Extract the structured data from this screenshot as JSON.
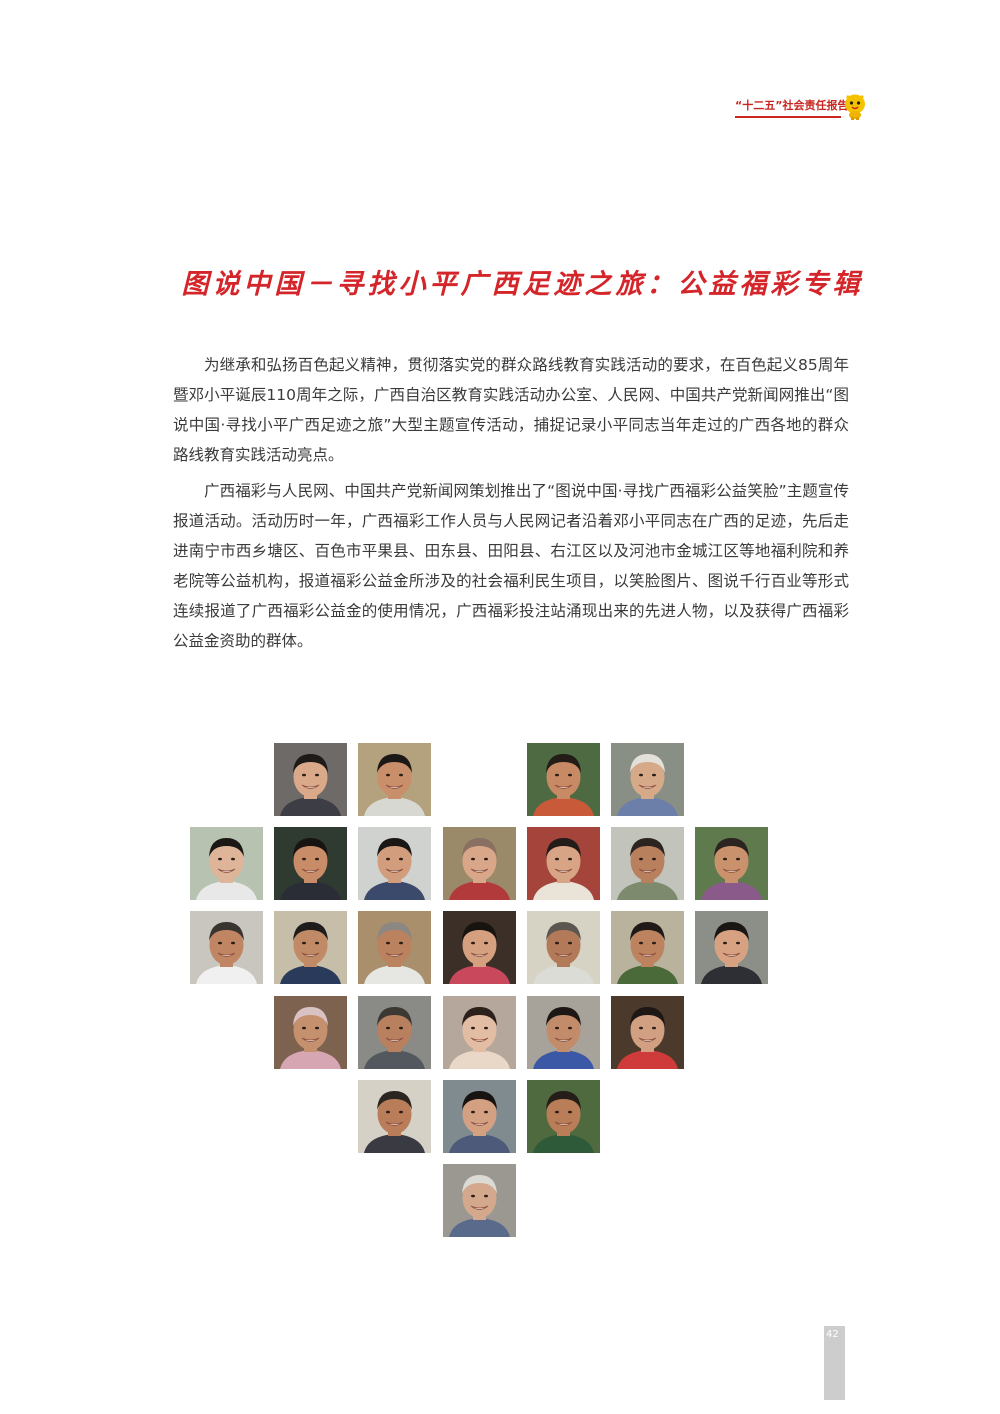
{
  "header": {
    "report_label": "“十二五”社会责任报告",
    "accent_color": "#c8261f",
    "mascot_icon": "mascot-icon"
  },
  "title": "图说中国－寻找小平广西足迹之旅：公益福彩专辑",
  "paragraphs": [
    "为继承和弘扬百色起义精神，贯彻落实党的群众路线教育实践活动的要求，在百色起义85周年暨邓小平诞辰110周年之际，广西自治区教育实践活动办公室、人民网、中国共产党新闻网推出“图说中国·寻找小平广西足迹之旅”大型主题宣传活动，捕捉记录小平同志当年走过的广西各地的群众路线教育实践活动亮点。",
    "广西福彩与人民网、中国共产党新闻网策划推出了“图说中国·寻找广西福彩公益笑脸”主题宣传报道活动。活动历时一年，广西福彩工作人员与人民网记者沿着邓小平同志在广西的足迹，先后走进南宁市西乡塘区、百色市平果县、田东县、田阳县、右江区以及河池市金城江区等地福利院和养老院等公益机构，报道福彩公益金所涉及的社会福利民生项目，以笑脸图片、图说千行百业等形式连续报道了广西福彩公益金的使用情况，广西福彩投注站涌现出来的先进人物，以及获得广西福彩公益金资助的群体。"
  ],
  "portraits": [
    {
      "row": 0,
      "col": 1,
      "bg": "#6d6a68",
      "skin": "#d9a98a",
      "hair": "#1e1a18",
      "shirt": "#3d3d45"
    },
    {
      "row": 0,
      "col": 2,
      "bg": "#b4a27e",
      "skin": "#c98f6b",
      "hair": "#1c1816",
      "shirt": "#d8d8d2"
    },
    {
      "row": 0,
      "col": 4,
      "bg": "#4e6a43",
      "skin": "#c78a64",
      "hair": "#231c17",
      "shirt": "#c85a3a"
    },
    {
      "row": 0,
      "col": 5,
      "bg": "#8a8f86",
      "skin": "#d6a988",
      "hair": "#e3e0da",
      "shirt": "#6b7fa8"
    },
    {
      "row": 1,
      "col": 0,
      "bg": "#b8c2b0",
      "skin": "#dfb59a",
      "hair": "#1b1715",
      "shirt": "#e8e8e8"
    },
    {
      "row": 1,
      "col": 1,
      "bg": "#2f3a30",
      "skin": "#c88c68",
      "hair": "#181412",
      "shirt": "#2a2d35"
    },
    {
      "row": 1,
      "col": 2,
      "bg": "#cfd2cf",
      "skin": "#d19d7c",
      "hair": "#1a1715",
      "shirt": "#3b4a6b"
    },
    {
      "row": 1,
      "col": 3,
      "bg": "#9a8a6a",
      "skin": "#d8a78a",
      "hair": "#8a6f63",
      "shirt": "#b23a3a"
    },
    {
      "row": 1,
      "col": 4,
      "bg": "#a4443a",
      "skin": "#d7a585",
      "hair": "#241c18",
      "shirt": "#e9e3d8"
    },
    {
      "row": 1,
      "col": 5,
      "bg": "#c2c4bc",
      "skin": "#b9805e",
      "hair": "#2b2420",
      "shirt": "#7d8a6e"
    },
    {
      "row": 1,
      "col": 6,
      "bg": "#5f7a4c",
      "skin": "#c9926d",
      "hair": "#2c2420",
      "shirt": "#8a5a8a"
    },
    {
      "row": 2,
      "col": 0,
      "bg": "#c9c6bf",
      "skin": "#c08664",
      "hair": "#3a3430",
      "shirt": "#f0f0f0"
    },
    {
      "row": 2,
      "col": 1,
      "bg": "#c6bea8",
      "skin": "#c18a66",
      "hair": "#1f1c1c",
      "shirt": "#2a3a5a"
    },
    {
      "row": 2,
      "col": 2,
      "bg": "#a98f6b",
      "skin": "#bb8260",
      "hair": "#8c8782",
      "shirt": "#e6e6e2"
    },
    {
      "row": 2,
      "col": 3,
      "bg": "#3c2f28",
      "skin": "#d4a080",
      "hair": "#17130f",
      "shirt": "#c9485b"
    },
    {
      "row": 2,
      "col": 4,
      "bg": "#d6d2c4",
      "skin": "#b27a58",
      "hair": "#5c5650",
      "shirt": "#dcdcd6"
    },
    {
      "row": 2,
      "col": 5,
      "bg": "#b9b29c",
      "skin": "#bd835f",
      "hair": "#1f1a17",
      "shirt": "#4a6a3a"
    },
    {
      "row": 2,
      "col": 6,
      "bg": "#8b8f88",
      "skin": "#d6a282",
      "hair": "#1a1614",
      "shirt": "#2e2e35"
    },
    {
      "row": 3,
      "col": 1,
      "bg": "#7d6250",
      "skin": "#c4906e",
      "hair": "#d9c2c4",
      "shirt": "#d6a6b2"
    },
    {
      "row": 3,
      "col": 2,
      "bg": "#8a8a86",
      "skin": "#b8805f",
      "hair": "#3c3834",
      "shirt": "#52585e"
    },
    {
      "row": 3,
      "col": 3,
      "bg": "#b5a79c",
      "skin": "#e3bda3",
      "hair": "#2b201b",
      "shirt": "#e9d7c8"
    },
    {
      "row": 3,
      "col": 4,
      "bg": "#a7a39a",
      "skin": "#c28c6a",
      "hair": "#1d1816",
      "shirt": "#3a58a5"
    },
    {
      "row": 3,
      "col": 5,
      "bg": "#4b3a2c",
      "skin": "#d1a083",
      "hair": "#1d1815",
      "shirt": "#cf3a3a"
    },
    {
      "row": 4,
      "col": 2,
      "bg": "#d5d1c6",
      "skin": "#b97d5a",
      "hair": "#2b2522",
      "shirt": "#3a3a42"
    },
    {
      "row": 4,
      "col": 3,
      "bg": "#7f8b8f",
      "skin": "#d3a182",
      "hair": "#161311",
      "shirt": "#4e5a7a"
    },
    {
      "row": 4,
      "col": 4,
      "bg": "#4f6a3e",
      "skin": "#b97d58",
      "hair": "#241d18",
      "shirt": "#2f5a3a"
    },
    {
      "row": 5,
      "col": 3,
      "bg": "#9b9892",
      "skin": "#d3a88c",
      "hair": "#dcdad5",
      "shirt": "#5a6a8a"
    }
  ],
  "page_number": "42"
}
